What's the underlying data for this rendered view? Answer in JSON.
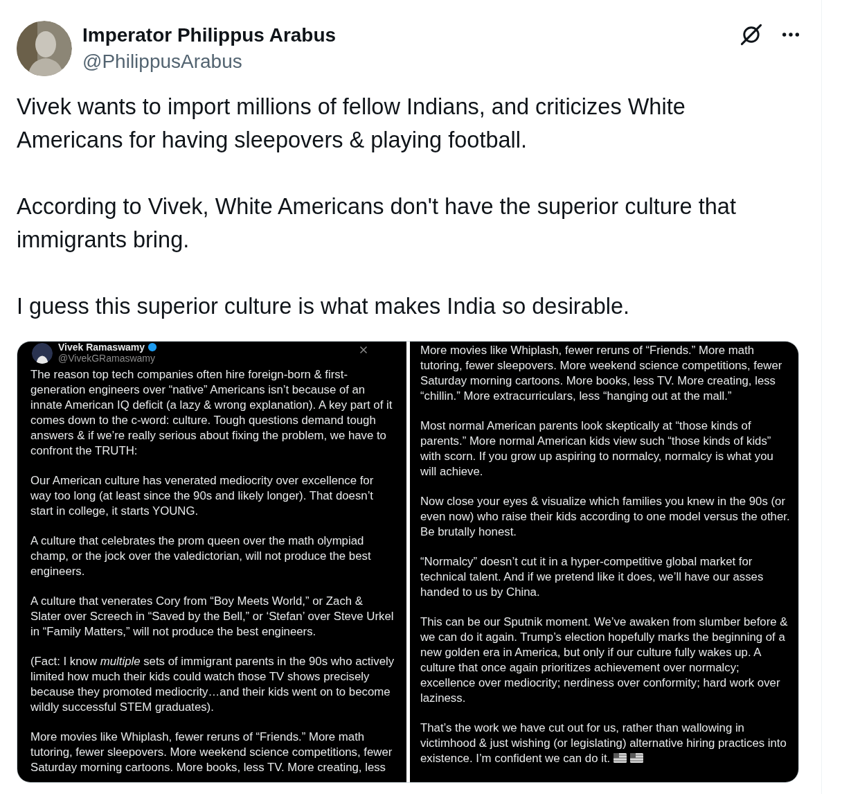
{
  "author": {
    "name": "Imperator Philippus Arabus",
    "handle": "@PhilippusArabus"
  },
  "body": [
    "Vivek wants to import millions of fellow Indians, and criticizes White Americans for having sleepovers & playing football.",
    "According to Vivek, White Americans don't have the superior culture that immigrants bring.",
    "I guess this superior culture is what makes India so desirable."
  ],
  "attachments": [
    {
      "header": {
        "name": "Vivek Ramaswamy",
        "handle": "@VivekGRamaswamy"
      },
      "paragraphs": [
        "The reason top tech companies often hire foreign-born & first-generation engineers over “native” Americans isn’t because of an innate American IQ deficit (a lazy & wrong explanation). A key part of it comes down to the c-word: culture. Tough questions demand tough answers & if we’re really serious about fixing the problem, we have to confront the TRUTH:",
        "Our American culture has venerated mediocrity over excellence for way too long (at least since the 90s and likely longer). That doesn’t start in college, it starts YOUNG.",
        "A culture that celebrates the prom queen over the math olympiad champ, or the jock over the valedictorian, will not produce the best engineers.",
        "A culture that venerates Cory from “Boy Meets World,” or Zach & Slater over Screech in “Saved by the Bell,” or ‘Stefan’ over Steve Urkel in “Family Matters,” will not produce the best engineers.",
        "(Fact: I know *multiple* sets of immigrant parents in the 90s who actively limited how much their kids could watch those TV shows precisely because they promoted mediocrity…and their kids went on to become wildly successful STEM graduates).",
        "More movies like Whiplash, fewer reruns of “Friends.” More math tutoring, fewer sleepovers. More weekend science competitions, fewer Saturday morning cartoons. More books, less TV. More creating, less"
      ]
    },
    {
      "paragraphs": [
        "More movies like Whiplash, fewer reruns of “Friends.” More math tutoring, fewer sleepovers. More weekend science competitions, fewer Saturday morning cartoons. More books, less TV. More creating, less “chillin.” More extracurriculars, less “hanging out at the mall.”",
        "Most normal American parents look skeptically at “those kinds of parents.” More normal American kids view such “those kinds of kids” with scorn. If you grow up aspiring to normalcy, normalcy is what you will achieve.",
        "Now close your eyes & visualize which families you knew in the 90s (or even now) who raise their kids according to one model versus the other. Be brutally honest.",
        "“Normalcy” doesn’t cut it in a hyper-competitive global market for technical talent. And if we pretend like it does, we’ll have our asses handed to us by China.",
        "This can be our Sputnik moment. We’ve awaken from slumber before & we can do it again. Trump’s election hopefully marks the beginning of a new golden era in America, but only if our culture fully wakes up. A culture that once again prioritizes achievement over normalcy; excellence over mediocrity; nerdiness over conformity; hard work over laziness.",
        "That’s the work we have cut out for us, rather than wallowing in victimhood & just wishing (or legislating) alternative hiring practices into existence. I’m confident we can do it."
      ],
      "end_marks": [
        {
          "kind": "flag"
        },
        {
          "kind": "flag"
        }
      ]
    }
  ]
}
